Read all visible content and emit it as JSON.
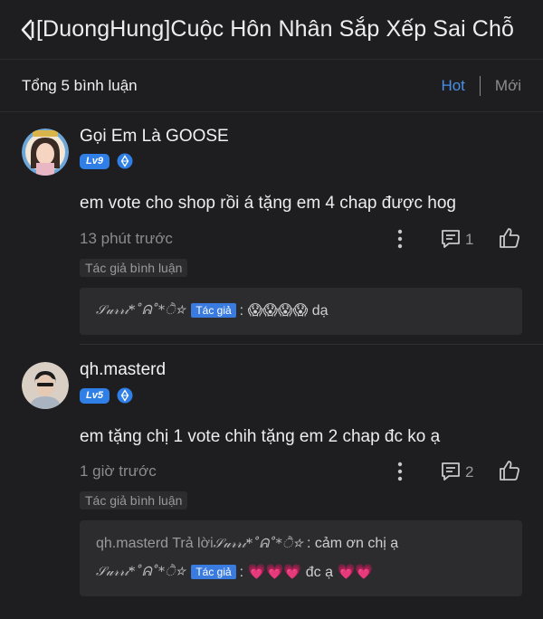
{
  "header": {
    "title": "[DuongHung]Cuộc Hôn Nhân Sắp Xếp Sai Chỗ"
  },
  "subbar": {
    "count": "Tổng 5 bình luận",
    "sort_hot": "Hot",
    "sort_new": "Mới"
  },
  "comments": [
    {
      "username": "Gọi Em Là GOOSE",
      "level": "Lv9",
      "text": "em vote cho shop rồi á tặng em 4 chap được hog",
      "time": "13 phút trước",
      "reply_count": "1",
      "author_tag": "Tác giả bình luận",
      "replies": [
        {
          "prefix": "",
          "signature": "𝒮𝓊𝓇𝓇𝒾*˚ᕱ˚*ੈ☆",
          "chip": "Tác giả",
          "text": ": 😱😱😱😱 dạ"
        }
      ]
    },
    {
      "username": "qh.masterd",
      "level": "Lv5",
      "text": "em tặng chị 1 vote chih tặng em 2 chap đc ko ạ",
      "time": "1 giờ trước",
      "reply_count": "2",
      "author_tag": "Tác giả bình luận",
      "replies": [
        {
          "prefix": "qh.masterd Trả lời ",
          "signature": "𝒮𝓊𝓇𝓇𝒾*˚ᕱ˚*ੈ☆",
          "text": ": cảm ơn chị ạ"
        },
        {
          "signature": "𝒮𝓊𝓇𝓇𝒾*˚ᕱ˚*ੈ☆",
          "chip": "Tác giả",
          "text": ": 💗💗💗 đc ạ 💗💗"
        }
      ]
    }
  ],
  "colors": {
    "background": "#1e1e20",
    "accent": "#4a8fe7",
    "level_badge": "#2f7fe6",
    "reply_box": "#2c2c2e"
  },
  "icons": [
    "back-arrow-icon",
    "diamond-icon",
    "more-vertical-icon",
    "reply-icon",
    "thumbs-up-icon"
  ]
}
